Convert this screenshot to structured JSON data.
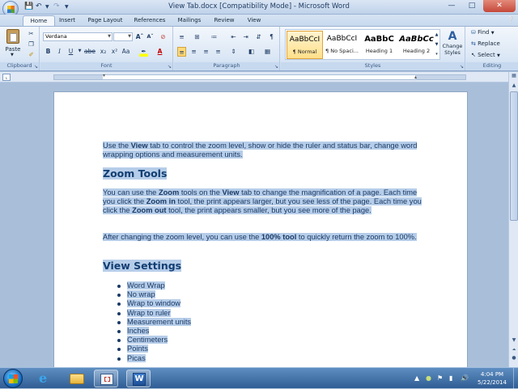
{
  "window": {
    "title": "View Tab.docx [Compatibility Mode] - Microsoft Word",
    "minimize": "—",
    "maximize": "□",
    "close": "✕"
  },
  "tabs": [
    "Home",
    "Insert",
    "Page Layout",
    "References",
    "Mailings",
    "Review",
    "View"
  ],
  "ribbon": {
    "clipboard": {
      "paste": "Paste",
      "label": "Clipboard"
    },
    "font": {
      "name": "Verdana",
      "size": "",
      "label": "Font"
    },
    "paragraph": {
      "label": "Paragraph"
    },
    "styles": {
      "label": "Styles",
      "items": [
        {
          "preview": "AaBbCcI",
          "name": "¶ Normal"
        },
        {
          "preview": "AaBbCcI",
          "name": "¶ No Spaci..."
        },
        {
          "preview": "AaBbC",
          "name": "Heading 1"
        },
        {
          "preview": "AaBbCc",
          "name": "Heading 2"
        }
      ],
      "change_styles": "Change Styles"
    },
    "editing": {
      "label": "Editing",
      "find": "Find",
      "replace": "Replace",
      "select": "Select"
    }
  },
  "document": {
    "intro": [
      {
        "t": "Use the "
      },
      {
        "t": "View",
        "b": true
      },
      {
        "t": " tab to control the zoom level, show or hide the ruler and status bar, change word wrapping options and measurement units."
      }
    ],
    "heading1": "Zoom Tools",
    "zoom_para": [
      {
        "t": "You can use the "
      },
      {
        "t": "Zoom",
        "b": true
      },
      {
        "t": " tools on the "
      },
      {
        "t": "View",
        "b": true
      },
      {
        "t": " tab to change the magnification of a page. Each time you click the "
      },
      {
        "t": "Zoom in",
        "b": true
      },
      {
        "t": " tool, the print appears larger, but you see less of the page. Each time you click the "
      },
      {
        "t": "Zoom out",
        "b": true
      },
      {
        "t": " tool, the print appears smaller, but you see more of the page."
      }
    ],
    "after_para": [
      {
        "t": "After changing the zoom level, you can use the "
      },
      {
        "t": "100% tool",
        "b": true
      },
      {
        "t": " to quickly return the zoom to 100%."
      }
    ],
    "heading2": "View Settings",
    "bullets": [
      "Word Wrap",
      "No wrap",
      "Wrap to window",
      "Wrap to ruler",
      "Measurement units",
      "Inches",
      "Centimeters",
      "Points",
      "Picas"
    ]
  },
  "taskbar": {
    "time": "4:04 PM",
    "date": "5/22/2014"
  },
  "colors": {
    "selection": "#b6cde9",
    "heading": "#123e72",
    "text": "#1a3a66"
  }
}
